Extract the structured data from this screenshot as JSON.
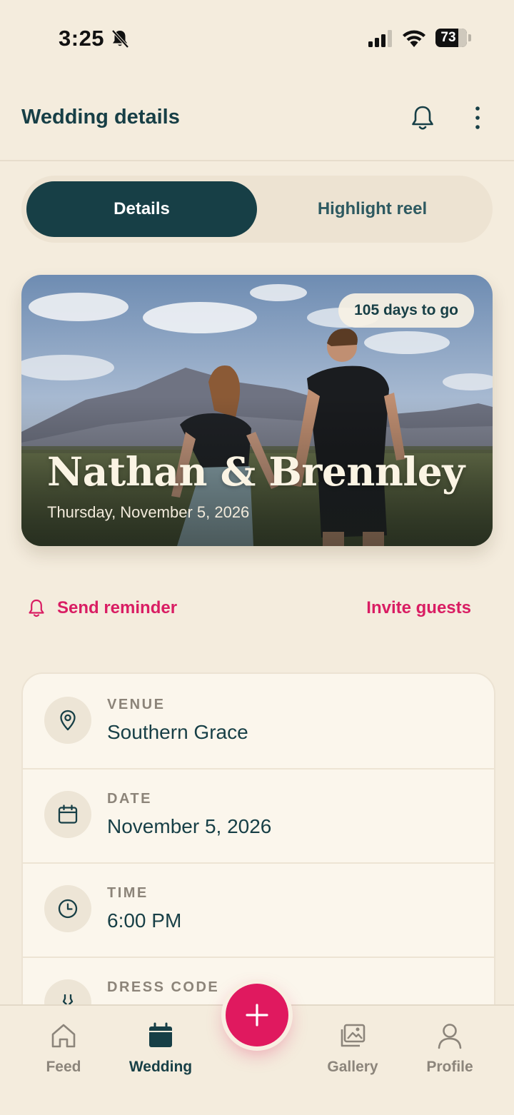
{
  "status_bar": {
    "time": "3:25",
    "battery": "73",
    "battery_level": 0.73
  },
  "header": {
    "title": "Wedding details"
  },
  "segmented": {
    "tabs": [
      {
        "label": "Details",
        "active": true
      },
      {
        "label": "Highlight reel",
        "active": false
      }
    ]
  },
  "hero": {
    "countdown": "105 days to go",
    "names": "Nathan & Brennley",
    "date": "Thursday, November 5, 2026"
  },
  "actions": {
    "send_reminder": "Send reminder",
    "invite_guests": "Invite guests"
  },
  "details": [
    {
      "label": "VENUE",
      "value": "Southern Grace",
      "icon": "location-pin-icon"
    },
    {
      "label": "DATE",
      "value": "November 5, 2026",
      "icon": "calendar-icon"
    },
    {
      "label": "TIME",
      "value": "6:00 PM",
      "icon": "clock-icon"
    },
    {
      "label": "DRESS CODE",
      "value": "",
      "icon": "dress-icon"
    }
  ],
  "nav": [
    {
      "label": "Feed",
      "icon": "home-icon",
      "active": false
    },
    {
      "label": "Wedding",
      "icon": "calendar-icon",
      "active": true
    },
    {
      "label": "Gallery",
      "icon": "gallery-icon",
      "active": false
    },
    {
      "label": "Profile",
      "icon": "profile-icon",
      "active": false
    }
  ],
  "colors": {
    "accent": "#d91d63",
    "primary": "#173f46",
    "background": "#f4ecdd"
  }
}
